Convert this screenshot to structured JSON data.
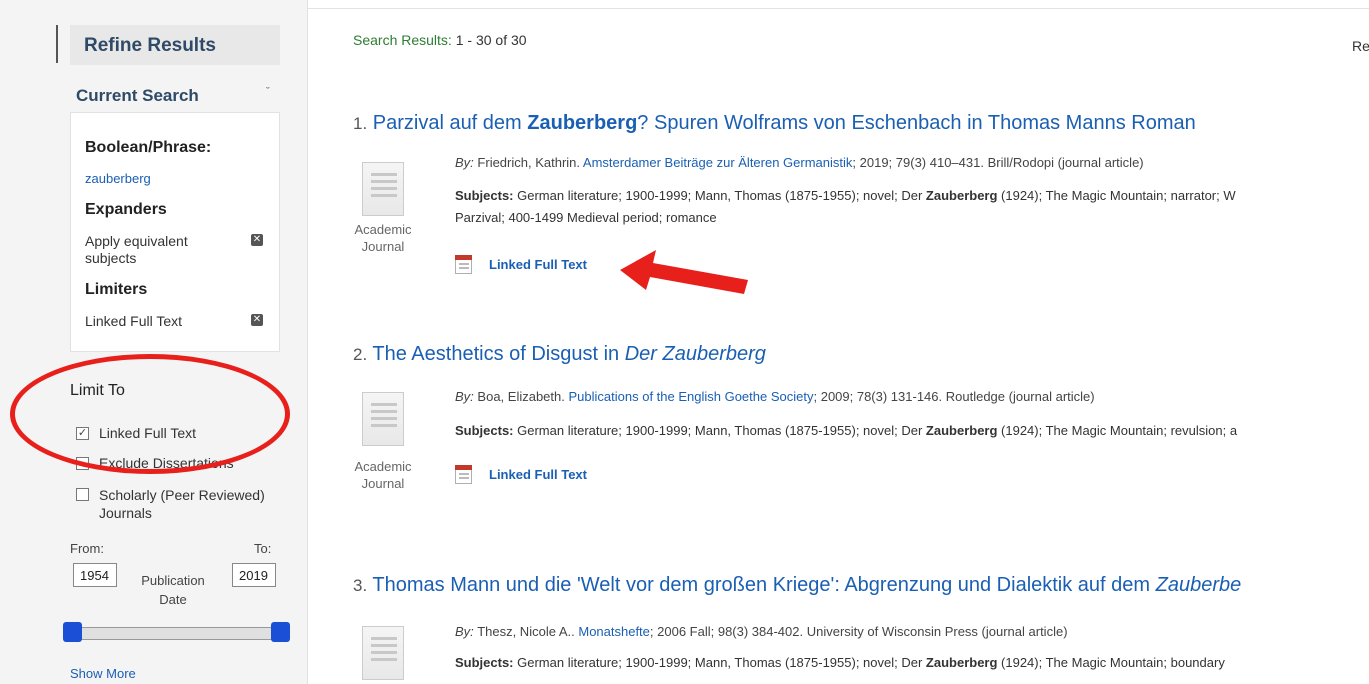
{
  "sidebar": {
    "refine_title": "Refine Results",
    "current_search_title": "Current Search",
    "boolean_label": "Boolean/Phrase:",
    "boolean_value": "zauberberg",
    "expanders_label": "Expanders",
    "expander_item": "Apply equivalent subjects",
    "limiters_label": "Limiters",
    "limiter_item": "Linked Full Text",
    "limit_to_title": "Limit To",
    "limit_options": [
      {
        "label": "Linked Full Text",
        "checked": true
      },
      {
        "label": "Exclude Dissertations",
        "checked": false
      },
      {
        "label": "Scholarly (Peer Reviewed) Journals",
        "checked": false
      }
    ],
    "from_label": "From:",
    "to_label": "To:",
    "from_value": "1954",
    "to_value": "2019",
    "pub_date_label": "Publication Date",
    "show_more": "Show More"
  },
  "main": {
    "results_label": "Search Results:",
    "results_range": "1 - 30 of 30",
    "relevance_cut": "Re",
    "results": [
      {
        "num": "1.",
        "title_pre": "Parzival auf dem ",
        "title_bold": "Zauberberg",
        "title_post": "? Spuren Wolframs von Eschenbach in Thomas Manns Roman",
        "by_label": "By:",
        "author": "Friedrich, Kathrin.",
        "source": "Amsterdamer Beiträge zur Älteren Germanistik",
        "details": "; 2019; 79(3) 410–431. Brill/Rodopi (journal article)",
        "subjects_label": "Subjects:",
        "subjects_pre": "German literature; 1900-1999; Mann, Thomas (1875-1955); novel; Der ",
        "subjects_bold": "Zauberberg",
        "subjects_post": " (1924); The Magic Mountain; narrator; W",
        "subjects_line2": "Parzival; 400-1499 Medieval period; romance",
        "doc_type": "Academic Journal",
        "full_text": "Linked Full Text"
      },
      {
        "num": "2.",
        "title_pre": "The Aesthetics of Disgust in ",
        "title_italic": "Der Zauberberg",
        "by_label": "By:",
        "author": "Boa, Elizabeth.",
        "source": "Publications of the English Goethe Society",
        "details": "; 2009; 78(3) 131-146. Routledge (journal article)",
        "subjects_label": "Subjects:",
        "subjects_pre": "German literature; 1900-1999; Mann, Thomas (1875-1955); novel; Der ",
        "subjects_bold": "Zauberberg",
        "subjects_post": " (1924); The Magic Mountain; revulsion; a",
        "doc_type": "Academic Journal",
        "full_text": "Linked Full Text"
      },
      {
        "num": "3.",
        "title_pre": "Thomas Mann und die 'Welt vor dem großen Kriege': Abgrenzung und Dialektik auf dem ",
        "title_italic": "Zauberbe",
        "by_label": "By:",
        "author": "Thesz, Nicole A..",
        "source": "Monatshefte",
        "details": "; 2006 Fall; 98(3) 384-402. University of Wisconsin Press (journal article)",
        "subjects_label": "Subjects:",
        "subjects_pre": "German literature; 1900-1999; Mann, Thomas (1875-1955); novel; Der ",
        "subjects_bold": "Zauberberg",
        "subjects_post": " (1924); The Magic Mountain; boundary"
      }
    ]
  },
  "colors": {
    "link": "#1a5fb4",
    "annotation_red": "#e8201c",
    "slider_handle": "#1a4fd6",
    "results_green": "#2e7d32"
  },
  "icons": [
    "document-icon",
    "pdf-icon",
    "remove-x-icon",
    "chevron-down-icon",
    "checkbox-icon",
    "arrow-annotation",
    "ellipse-annotation"
  ]
}
